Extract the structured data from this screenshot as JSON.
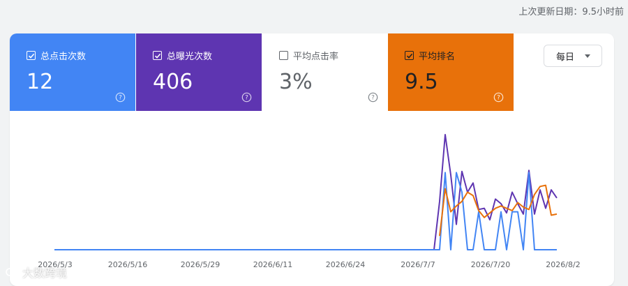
{
  "last_update": "上次更新日期：9.5小时前",
  "metrics": [
    {
      "label": "总点击次数",
      "value": "12",
      "checked": true
    },
    {
      "label": "总曝光次数",
      "value": "406",
      "checked": true
    },
    {
      "label": "平均点击率",
      "value": "3%",
      "checked": false
    },
    {
      "label": "平均排名",
      "value": "9.5",
      "checked": true
    }
  ],
  "period_select": {
    "value": "每日"
  },
  "watermark": "大数跨境",
  "colors": {
    "clicks": "#4285f4",
    "impressions": "#5e35b1",
    "ctr": "#ffffff",
    "position": "#e8710a"
  },
  "chart_data": {
    "type": "line",
    "x_tick_labels": [
      "2026/5/3",
      "2026/5/16",
      "2026/5/29",
      "2026/6/11",
      "2026/6/24",
      "2026/7/7",
      "2026/7/20",
      "2026/8/2"
    ],
    "x_start": "2026/5/3",
    "x_end": "2026/8/2",
    "series": [
      {
        "key": "impressions",
        "color": "#5e35b1",
        "values": {
          "2026/7/10": 0,
          "2026/7/11": 0.42,
          "2026/7/12": 1.0,
          "2026/7/13": 0.65,
          "2026/7/14": 0.22,
          "2026/7/15": 0.68,
          "2026/7/16": 0.5,
          "2026/7/17": 0.58,
          "2026/7/18": 0.35,
          "2026/7/19": 0.36,
          "2026/7/20": 0.26,
          "2026/7/21": 0.44,
          "2026/7/22": 0.4,
          "2026/7/23": 0.32,
          "2026/7/24": 0.5,
          "2026/7/25": 0.4,
          "2026/7/26": 0.31,
          "2026/7/27": 0.69,
          "2026/7/28": 0.31,
          "2026/7/29": 0.52,
          "2026/7/30": 0.36,
          "2026/7/31": 0.52,
          "2026/8/1": 0.45
        }
      },
      {
        "key": "clicks",
        "color": "#4285f4",
        "values": {
          "2026/7/10": 0,
          "2026/7/11": 0.0,
          "2026/7/12": 0.67,
          "2026/7/13": 0,
          "2026/7/14": 0.67,
          "2026/7/15": 0.5,
          "2026/7/16": 0,
          "2026/7/17": 0,
          "2026/7/18": 0.33,
          "2026/7/19": 0,
          "2026/7/20": 0,
          "2026/7/21": 0,
          "2026/7/22": 0.33,
          "2026/7/23": 0,
          "2026/7/24": 0.33,
          "2026/7/25": 0.33,
          "2026/7/26": 0,
          "2026/7/27": 0.67,
          "2026/7/28": 0,
          "2026/7/29": 0,
          "2026/7/30": 0,
          "2026/7/31": 0,
          "2026/8/1": 0
        }
      },
      {
        "key": "position",
        "color": "#e8710a",
        "values": {
          "2026/7/11": 0.12,
          "2026/7/12": 0.53,
          "2026/7/13": 0.33,
          "2026/7/14": 0.38,
          "2026/7/15": 0.42,
          "2026/7/16": 0.5,
          "2026/7/17": 0.47,
          "2026/7/18": 0.34,
          "2026/7/19": 0.28,
          "2026/7/20": 0.32,
          "2026/7/21": 0.36,
          "2026/7/22": 0.38,
          "2026/7/23": 0.36,
          "2026/7/24": 0.34,
          "2026/7/25": 0.41,
          "2026/7/26": 0.37,
          "2026/7/27": 0.35,
          "2026/7/28": 0.48,
          "2026/7/29": 0.55,
          "2026/7/30": 0.56,
          "2026/7/31": 0.3,
          "2026/8/1": 0.31
        }
      }
    ]
  }
}
